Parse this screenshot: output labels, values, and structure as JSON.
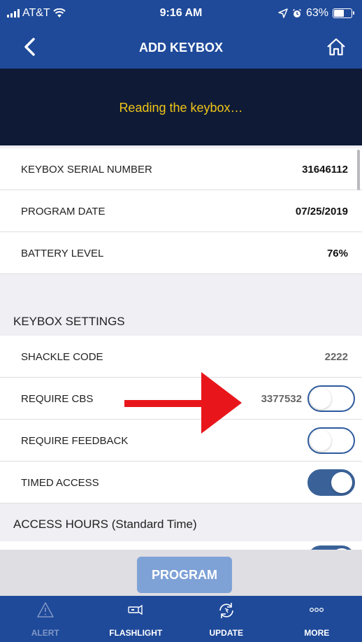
{
  "status_bar": {
    "carrier": "AT&T",
    "time": "9:16 AM",
    "battery_percent": "63%",
    "battery_level": 0.63
  },
  "nav": {
    "title": "ADD KEYBOX",
    "back_icon": "chevron-left-icon",
    "home_icon": "home-icon"
  },
  "banner": {
    "message": "Reading the keybox…"
  },
  "info_rows": [
    {
      "label": "KEYBOX SERIAL NUMBER",
      "value": "31646112"
    },
    {
      "label": "PROGRAM DATE",
      "value": "07/25/2019"
    },
    {
      "label": "BATTERY LEVEL",
      "value": "76%"
    }
  ],
  "settings": {
    "section_title": "KEYBOX SETTINGS",
    "shackle_code": {
      "label": "SHACKLE CODE",
      "value": "2222"
    },
    "require_cbs": {
      "label": "REQUIRE CBS",
      "value": "3377532",
      "enabled": false
    },
    "require_feedback": {
      "label": "REQUIRE FEEDBACK",
      "enabled": false
    },
    "timed_access": {
      "label": "TIMED ACCESS",
      "enabled": true
    }
  },
  "access_hours": {
    "section_title": "ACCESS HOURS (Standard Time)"
  },
  "footer": {
    "program_label": "PROGRAM"
  },
  "tabs": [
    {
      "label": "ALERT",
      "icon": "warning-icon",
      "active": true
    },
    {
      "label": "FLASHLIGHT",
      "icon": "flashlight-icon",
      "active": false
    },
    {
      "label": "UPDATE",
      "icon": "sync-icon",
      "active": false
    },
    {
      "label": "MORE",
      "icon": "more-icon",
      "active": false
    }
  ],
  "colors": {
    "brand_blue": "#1f4a9a",
    "banner_bg": "#0f1b36",
    "banner_text": "#f0c419",
    "toggle_on": "#3a6299",
    "button_blue": "#7ea1d6",
    "annotation_red": "#e8161b"
  }
}
